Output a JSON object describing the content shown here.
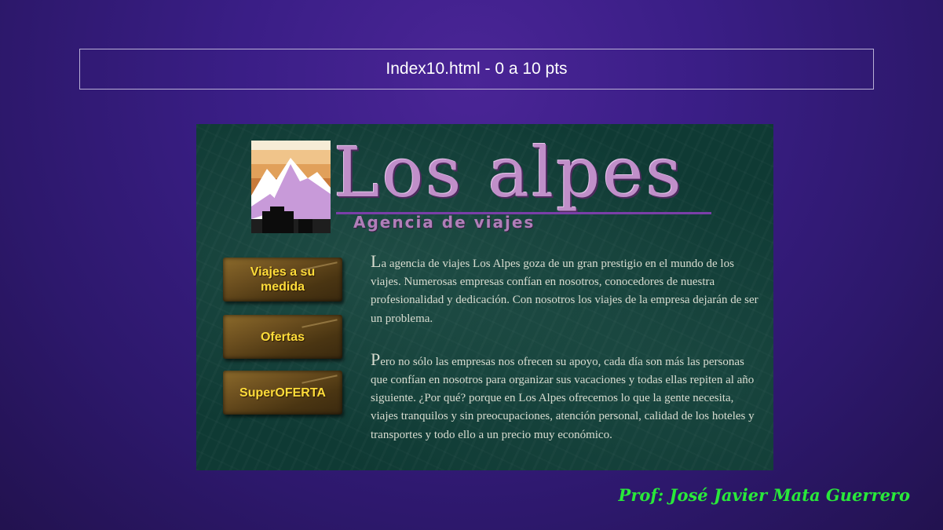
{
  "slide": {
    "title": "Index10.html - 0 a 10 pts",
    "credit": "Prof: José Javier Mata Guerrero"
  },
  "site": {
    "brand": "Los alpes",
    "tagline": "Agencia de viajes",
    "nav": [
      {
        "label": "Viajes a su medida",
        "icon": "gold-plaque-button"
      },
      {
        "label": "Ofertas",
        "icon": "gold-plaque-button"
      },
      {
        "label": "SuperOFERTA",
        "icon": "gold-plaque-button"
      }
    ],
    "paragraphs": [
      {
        "initial": "L",
        "text": "a agencia de viajes Los Alpes goza de un gran prestigio en el mundo de los viajes. Numerosas empresas confían en nosotros, conocedores de nuestra profesionalidad y dedicación. Con nosotros los viajes de la empresa dejarán de ser un problema."
      },
      {
        "initial": "P",
        "text": "ero no sólo las empresas nos ofrecen su apoyo, cada día son más las personas que confían en nosotros para organizar sus vacaciones y todas ellas repiten al año siguiente. ¿Por qué? porque en Los Alpes ofrecemos lo que la gente necesita, viajes tranquilos y sin preocupaciones, atención personal, calidad de los hoteles y transportes y todo ello a un precio muy económico."
      }
    ]
  },
  "colors": {
    "background": "#3a1e86",
    "panel": "#0f3a34",
    "brand": "#c08fc9",
    "button_text": "#ffdc3a",
    "credit": "#29e83a"
  }
}
